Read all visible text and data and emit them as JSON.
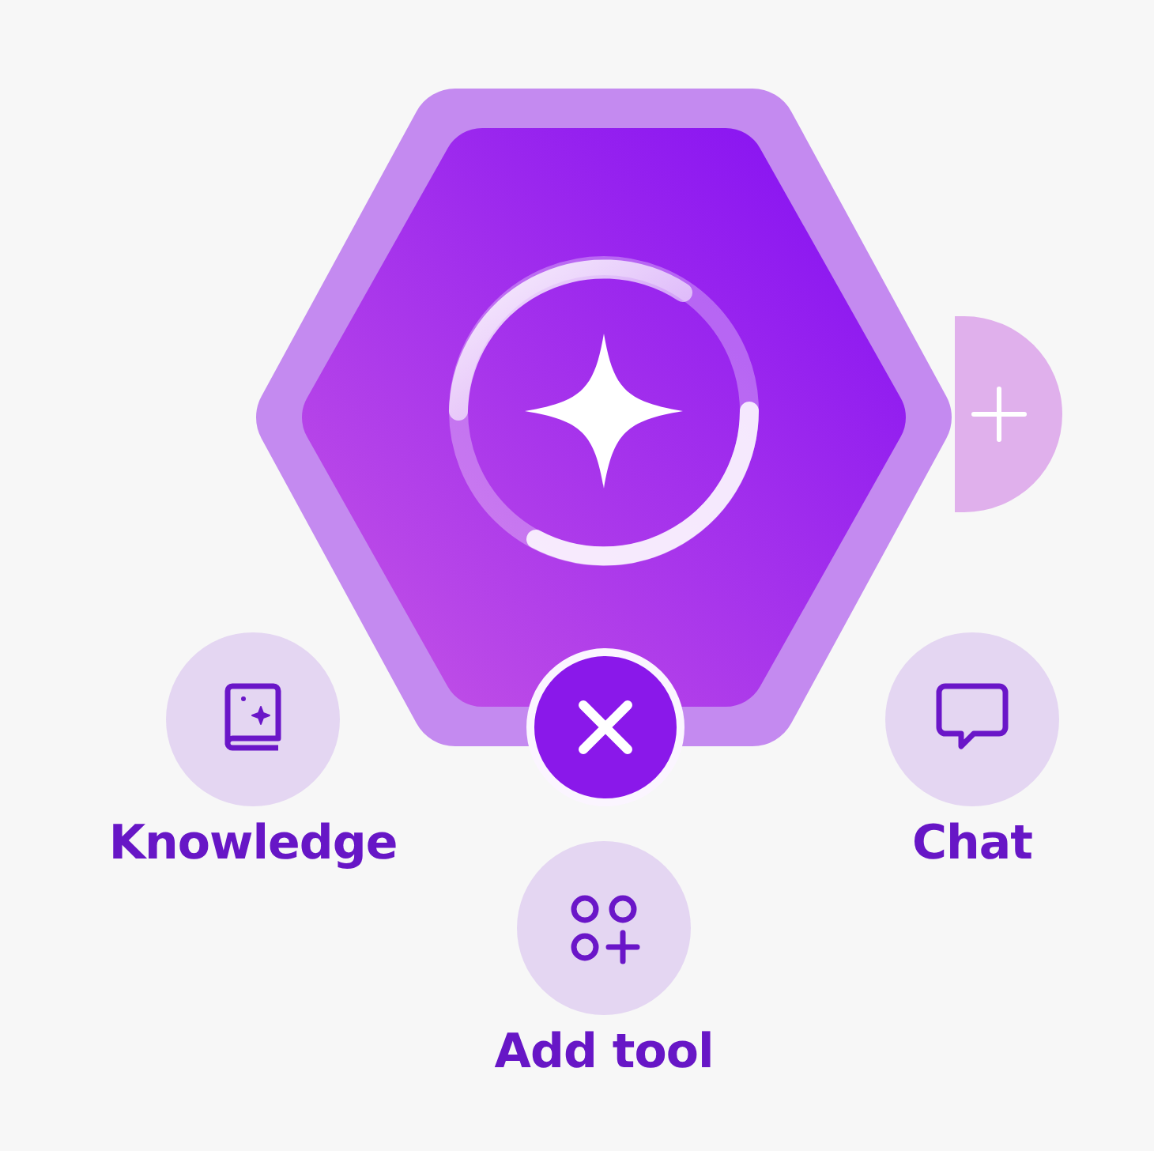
{
  "hub": {
    "expanded": true
  },
  "actions": [
    {
      "label": "Knowledge",
      "kind": "knowledge"
    },
    {
      "label": "Chat",
      "kind": "chat"
    },
    {
      "label": "Add tool",
      "kind": "add-tool"
    }
  ]
}
